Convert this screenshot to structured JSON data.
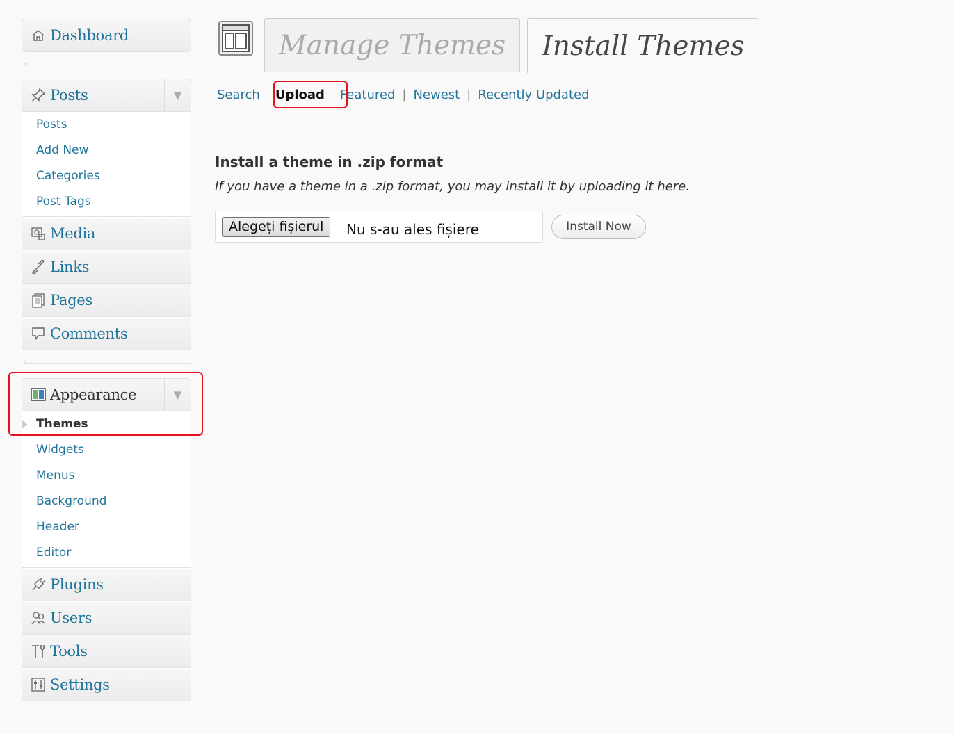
{
  "sidebar": {
    "dashboard": "Dashboard",
    "posts": {
      "label": "Posts",
      "items": [
        "Posts",
        "Add New",
        "Categories",
        "Post Tags"
      ]
    },
    "media": "Media",
    "links": "Links",
    "pages": "Pages",
    "comments": "Comments",
    "appearance": {
      "label": "Appearance",
      "items": [
        "Themes",
        "Widgets",
        "Menus",
        "Background",
        "Header",
        "Editor"
      ],
      "current": "Themes"
    },
    "plugins": "Plugins",
    "users": "Users",
    "tools": "Tools",
    "settings": "Settings",
    "collapse_glyph": "«"
  },
  "header": {
    "tabs": [
      {
        "label": "Manage Themes",
        "active": false
      },
      {
        "label": "Install Themes",
        "active": true
      }
    ]
  },
  "subnav": {
    "search": "Search",
    "upload": "Upload",
    "featured": "Featured",
    "newest": "Newest",
    "recently_updated": "Recently Updated",
    "separator": "|"
  },
  "content": {
    "heading": "Install a theme in .zip format",
    "description": "If you have a theme in a .zip format, you may install it by uploading it here.",
    "file_button": "Alegeți fișierul",
    "file_status": "Nu s-au ales fișiere",
    "install_button": "Install Now"
  },
  "colors": {
    "link": "#21759b",
    "highlight": "#e8101c",
    "background": "#f9f9f9"
  }
}
